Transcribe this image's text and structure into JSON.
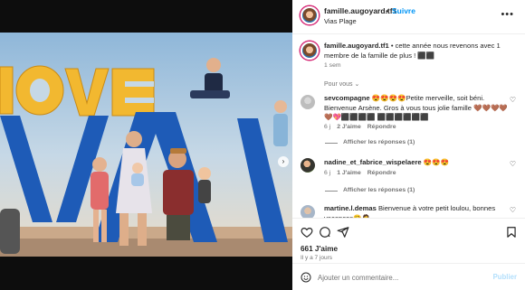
{
  "post": {
    "username": "famille.augoyard.tf1",
    "separator": "•",
    "follow_label": "Suivre",
    "location": "Vias Plage",
    "more_icon": "more-horizontal-icon"
  },
  "caption": {
    "username": "famille.augoyard.tf1",
    "text": " • cette année nous revenons avec 1 membre de la famille de plus ! ⬛⬛",
    "time": "1 sem"
  },
  "pour_vous_label": "Pour vous",
  "comments": [
    {
      "username": "sevcompagne",
      "text": " 😍😍😍😍Petite merveille, soit béni. Bienvenue Arsène. Gros à vous tous jolie famille 🤎🤎🤎🤎🤎💖⬛⬛⬛⬛ ⬛⬛⬛⬛⬛⬛",
      "time": "6 j",
      "likes": "2 J'aime",
      "reply": "Répondre",
      "see_replies": "Afficher les réponses (1)"
    },
    {
      "username": "nadine_et_fabrice_wispelaere",
      "text": " 😍😍😍",
      "time": "6 j",
      "likes": "1 J'aime",
      "reply": "Répondre",
      "see_replies": "Afficher les réponses (1)"
    },
    {
      "username": "martine.l.demas",
      "text": " Bienvenue à votre petit loulou, bonnes vacances🤗🤦",
      "time": "",
      "likes": "",
      "reply": ""
    }
  ],
  "likes_count": "661 J'aime",
  "posted_ago": "Il y a 7 jours",
  "composer": {
    "placeholder": "Ajouter un commentaire...",
    "publish": "Publier"
  },
  "colors": {
    "follow": "#0095f6",
    "publish_disabled": "#b2dffc",
    "muted": "#737373",
    "text": "#262626",
    "love_letters": "#f2b830",
    "big_letters": "#1e5bb7"
  }
}
